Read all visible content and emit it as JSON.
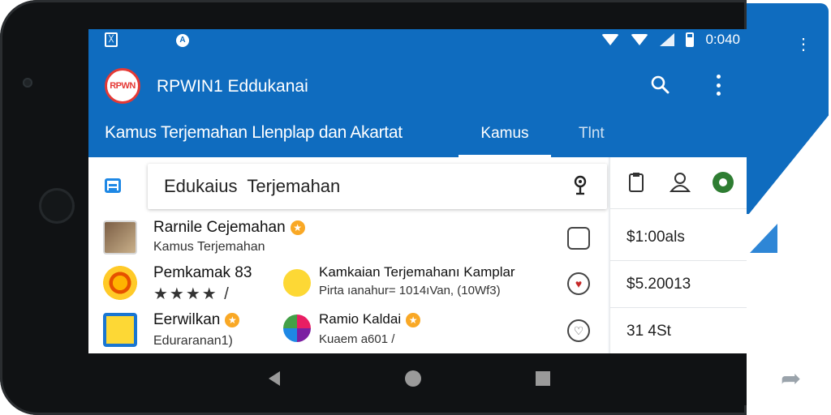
{
  "statusbar": {
    "time": "0:040",
    "left_icon_1": "sim-icon",
    "left_icon_2": "notification-icon"
  },
  "appbar": {
    "logo_text": "RPWN",
    "title": "RPWIN1 Eddukanai"
  },
  "tabs": {
    "main": "Kamus Terjemahan Llenplap dan Akartat",
    "active": "Kamus",
    "other": "Tlnt"
  },
  "search": {
    "value": "Edukaius  Terjemahan"
  },
  "rows": [
    {
      "title": "Rarnile  Cejemahan",
      "subtitle": "Kamus Terjemahan",
      "badge": "★"
    },
    {
      "title": "Pemkamak  83",
      "stars": "★★★★ /",
      "mid_title": "Kamkaian Terjemahanı Kamplar",
      "mid_subtitle": "Pirta ıanahur= 1014ıVan, (10Wf3)"
    },
    {
      "title": "Eerwilkan",
      "subtitle": "Eduraranan1)",
      "badge": "★",
      "mid_title": "Ramio Kaldai",
      "mid_subtitle": "Kuaem a601 /",
      "mid_badge": "★"
    }
  ],
  "right_values": [
    "$1:00als",
    "$5.20013",
    "31 4St"
  ],
  "colors": {
    "primary": "#0f6cbf",
    "accent": "#f9a825",
    "green": "#2e7d32"
  }
}
